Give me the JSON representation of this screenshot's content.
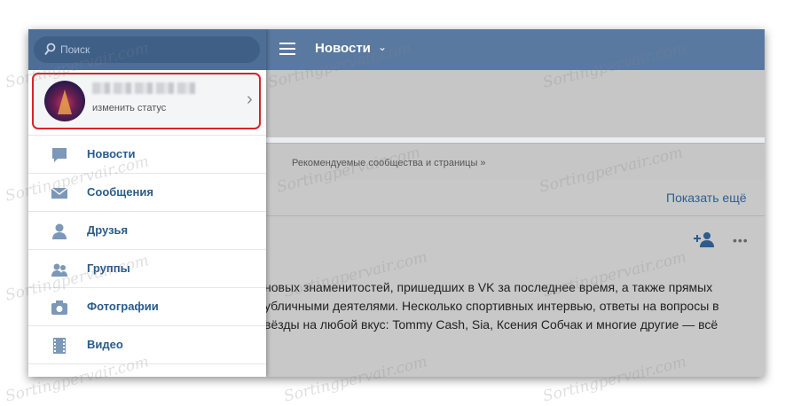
{
  "search": {
    "placeholder": "Поиск"
  },
  "header": {
    "title": "Новости",
    "caret": "⌄"
  },
  "profile": {
    "status": "изменить статус"
  },
  "menu": [
    {
      "label": "Новости",
      "icon": "news-icon"
    },
    {
      "label": "Сообщения",
      "icon": "envelope-icon"
    },
    {
      "label": "Друзья",
      "icon": "person-icon"
    },
    {
      "label": "Группы",
      "icon": "group-icon"
    },
    {
      "label": "Фотографии",
      "icon": "camera-icon"
    },
    {
      "label": "Видео",
      "icon": "film-icon"
    }
  ],
  "feed": {
    "recommend": "Рекомендуемые сообщества и страницы »",
    "show_more": "Показать ещё",
    "post_lines": [
      "новых знаменитостей, пришедших в VK за последнее время, а также прямых",
      "убличными деятелями. Несколько спортивных интервью, ответы на вопросы в",
      "вёзды на любой вкус: Tommy Cash, Sia, Ксения Собчак и многие другие — всё"
    ],
    "more": "•••"
  },
  "watermark": "Sortingpervair.com",
  "colors": {
    "header": "#5a79a0",
    "drawer_header": "#4e6e96",
    "highlight": "#d9232b",
    "link": "#2a5f96"
  }
}
